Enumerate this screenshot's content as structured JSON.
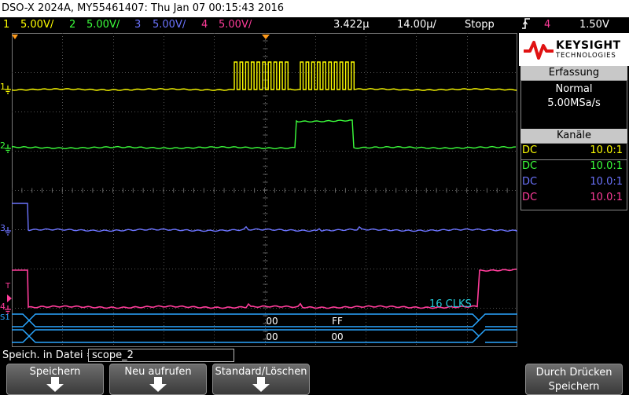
{
  "title": "DSO-X 2024A, MY55461407: Thu Jan 07 00:15:43 2016",
  "status": {
    "channels": [
      {
        "num": "1",
        "scale": "5.00V/",
        "color": "#ffff00"
      },
      {
        "num": "2",
        "scale": "5.00V/",
        "color": "#3cff3c"
      },
      {
        "num": "3",
        "scale": "5.00V/",
        "color": "#6c74ff"
      },
      {
        "num": "4",
        "scale": "5.00V/",
        "color": "#ff3c9a"
      }
    ],
    "delay": "3.422µ",
    "timebase": "14.00µ/",
    "run_state": "Stopp",
    "trigger_source": "4",
    "trigger_level": "1.50V"
  },
  "logo": {
    "brand": "KEYSIGHT",
    "sub": "TECHNOLOGIES"
  },
  "acquisition": {
    "header": "Erfassung",
    "mode": "Normal",
    "rate": "5.00MSa/s"
  },
  "channels_panel": {
    "header": "Kanäle",
    "rows": [
      {
        "coupling": "DC",
        "probe": "10.0:1",
        "color": "#ffff00"
      },
      {
        "coupling": "DC",
        "probe": "10.0:1",
        "color": "#3cff3c"
      },
      {
        "coupling": "DC",
        "probe": "10.0:1",
        "color": "#6c74ff"
      },
      {
        "coupling": "DC",
        "probe": "10.0:1",
        "color": "#ff3c9a"
      }
    ]
  },
  "markers": {
    "ch1": "1",
    "ch2": "2",
    "ch3": "3",
    "ch4": "4",
    "trigger": "T",
    "serial": "S1"
  },
  "decode": {
    "annotation": "16 CLKS",
    "bus1": [
      "00",
      "FF"
    ],
    "bus2": [
      "00",
      "00"
    ],
    "bus_color": "#2aa6ff",
    "annotation_color": "#23c8d6"
  },
  "file": {
    "label": "Speich. in Datei =",
    "value": "scope_2"
  },
  "softkeys": [
    "Speichern",
    "Neu aufrufen",
    "Standard/Löschen",
    "Durch Drücken Speichern"
  ]
}
